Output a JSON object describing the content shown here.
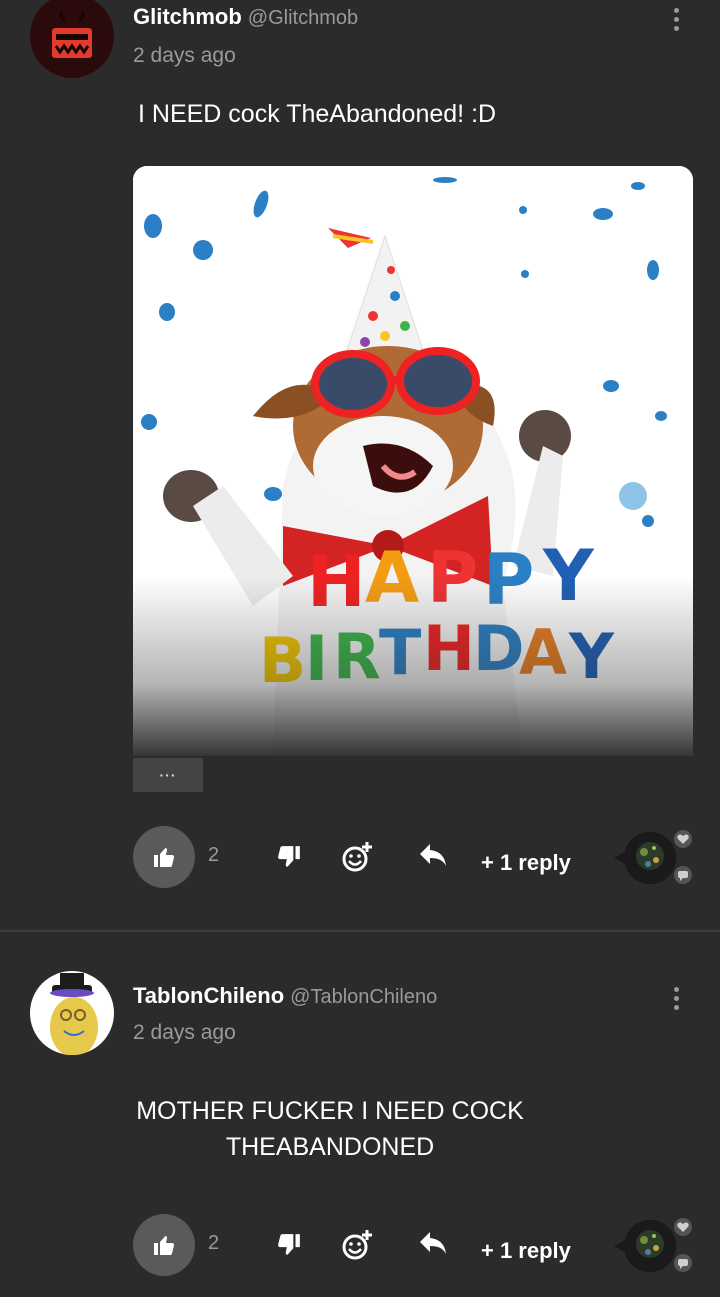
{
  "comments": [
    {
      "author": "Glitchmob",
      "handle": "@Glitchmob",
      "time": "2 days ago",
      "text": "I NEED cock TheAbandoned! :D",
      "media_more": "···",
      "likes": "2",
      "replies": "+ 1 reply",
      "avatar_icon": "glitchmob-avatar-icon"
    },
    {
      "author": "TablonChileno",
      "handle": "@TablonChileno",
      "time": "2 days ago",
      "text": "MOTHER FUCKER I NEED COCK THEABANDONED",
      "likes": "2",
      "replies": "+ 1 reply",
      "avatar_icon": "mr-peanutbutter-avatar-icon"
    }
  ],
  "media": {
    "alt": "happy-birthday-dog-gif",
    "letters_top": [
      "H",
      "A",
      "P",
      "P",
      "Y"
    ],
    "letters_bottom": [
      "B",
      "I",
      "R",
      "T",
      "H",
      "D",
      "A",
      "Y"
    ]
  },
  "colors": {
    "background": "#2b2b2b",
    "muted_text": "#9a9a9a",
    "like_button": "#5a5a5a"
  }
}
